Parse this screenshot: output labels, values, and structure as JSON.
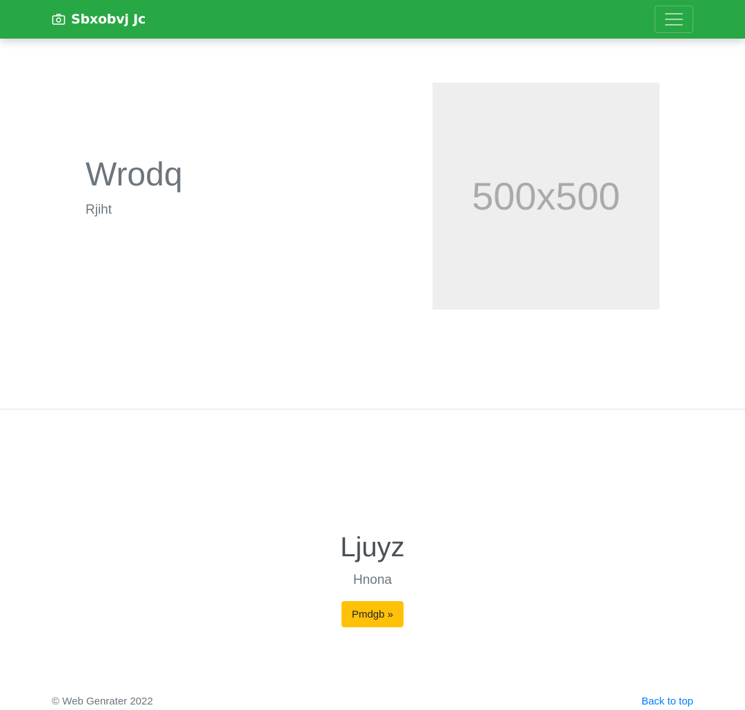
{
  "navbar": {
    "brand_icon": "camera-icon",
    "brand_text": "Sbxobvj Jc",
    "toggler_icon": "hamburger-menu-icon",
    "background_color": "#28a745"
  },
  "hero": {
    "title": "Wrodq",
    "subtitle": "Rjiht",
    "image_placeholder_text": "500x500"
  },
  "cta": {
    "title": "Ljuyz",
    "subtitle": "Hnona",
    "button_label": "Pmdgb »",
    "button_color": "#ffc107"
  },
  "footer": {
    "copyright": "© Web Genrater 2022",
    "back_to_top": "Back to top",
    "link_color": "#007bff"
  }
}
